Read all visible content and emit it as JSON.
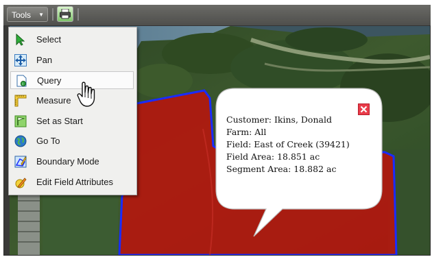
{
  "toolbar": {
    "tools_label": "Tools",
    "tools_caret": "▼"
  },
  "menu": {
    "items": [
      {
        "label": "Select",
        "icon": "arrow-pointer-icon"
      },
      {
        "label": "Pan",
        "icon": "pan-arrows-icon"
      },
      {
        "label": "Query",
        "icon": "query-document-icon",
        "hovered": true
      },
      {
        "label": "Measure",
        "icon": "ruler-icon"
      },
      {
        "label": "Set as Start",
        "icon": "flag-icon"
      },
      {
        "label": "Go To",
        "icon": "globe-icon"
      },
      {
        "label": "Boundary Mode",
        "icon": "boundary-edit-icon"
      },
      {
        "label": "Edit Field Attributes",
        "icon": "pencil-edit-icon"
      }
    ]
  },
  "popup": {
    "customer": "Customer: Ikins, Donald",
    "farm": "Farm: All",
    "field": "Field: East of Creek (39421)",
    "field_area": "Field Area: 18.851 ac",
    "segment_area": "Segment Area: 18.882 ac"
  },
  "colors": {
    "field_fill": "#b8140e",
    "field_boundary": "#1a2cff",
    "close_button": "#e93c4a"
  }
}
